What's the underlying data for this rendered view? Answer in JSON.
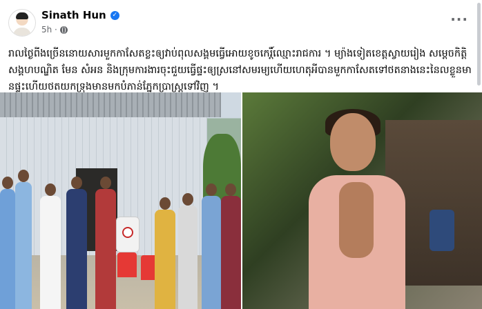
{
  "post": {
    "author": "Sinath Hun",
    "verified": true,
    "time": "5h ·",
    "privacy_icon": "globe-icon",
    "more_icon": "more-options-icon",
    "more_label": "···",
    "text": "រាលថ្ងៃពីងច្រើននោយសារមួកកាសែតខ្លះឲ្យវាប់ពុលសង្គមធ្វើអោយខូចកេរ្តិ៍ឈ្មោះរាជការ ។ ម្យ៉ាងទៀតខេត្តស្វាយរៀង សម្តេចកិត្តិសង្គហបណ្ឌិត មែន សំអន និងក្រុមការងារចុះជួយធ្វើផ្ទះឲ្យស្រនៅសមរម្យហើយហេតុអីបានមួកកាសែតទៅថតនាងនេះនៃលខ្លួនមានផ្ទះហើយថតយកទ្រុងមានមកបំភាន់ភ្នែកប្រាស្រ្តទៅវិញ ។"
  },
  "colors": {
    "accent": "#1877f2",
    "text": "#050505",
    "secondary_text": "#65676b"
  },
  "photos": [
    {
      "name": "photo-house-handover"
    },
    {
      "name": "photo-woman-shelter"
    }
  ]
}
